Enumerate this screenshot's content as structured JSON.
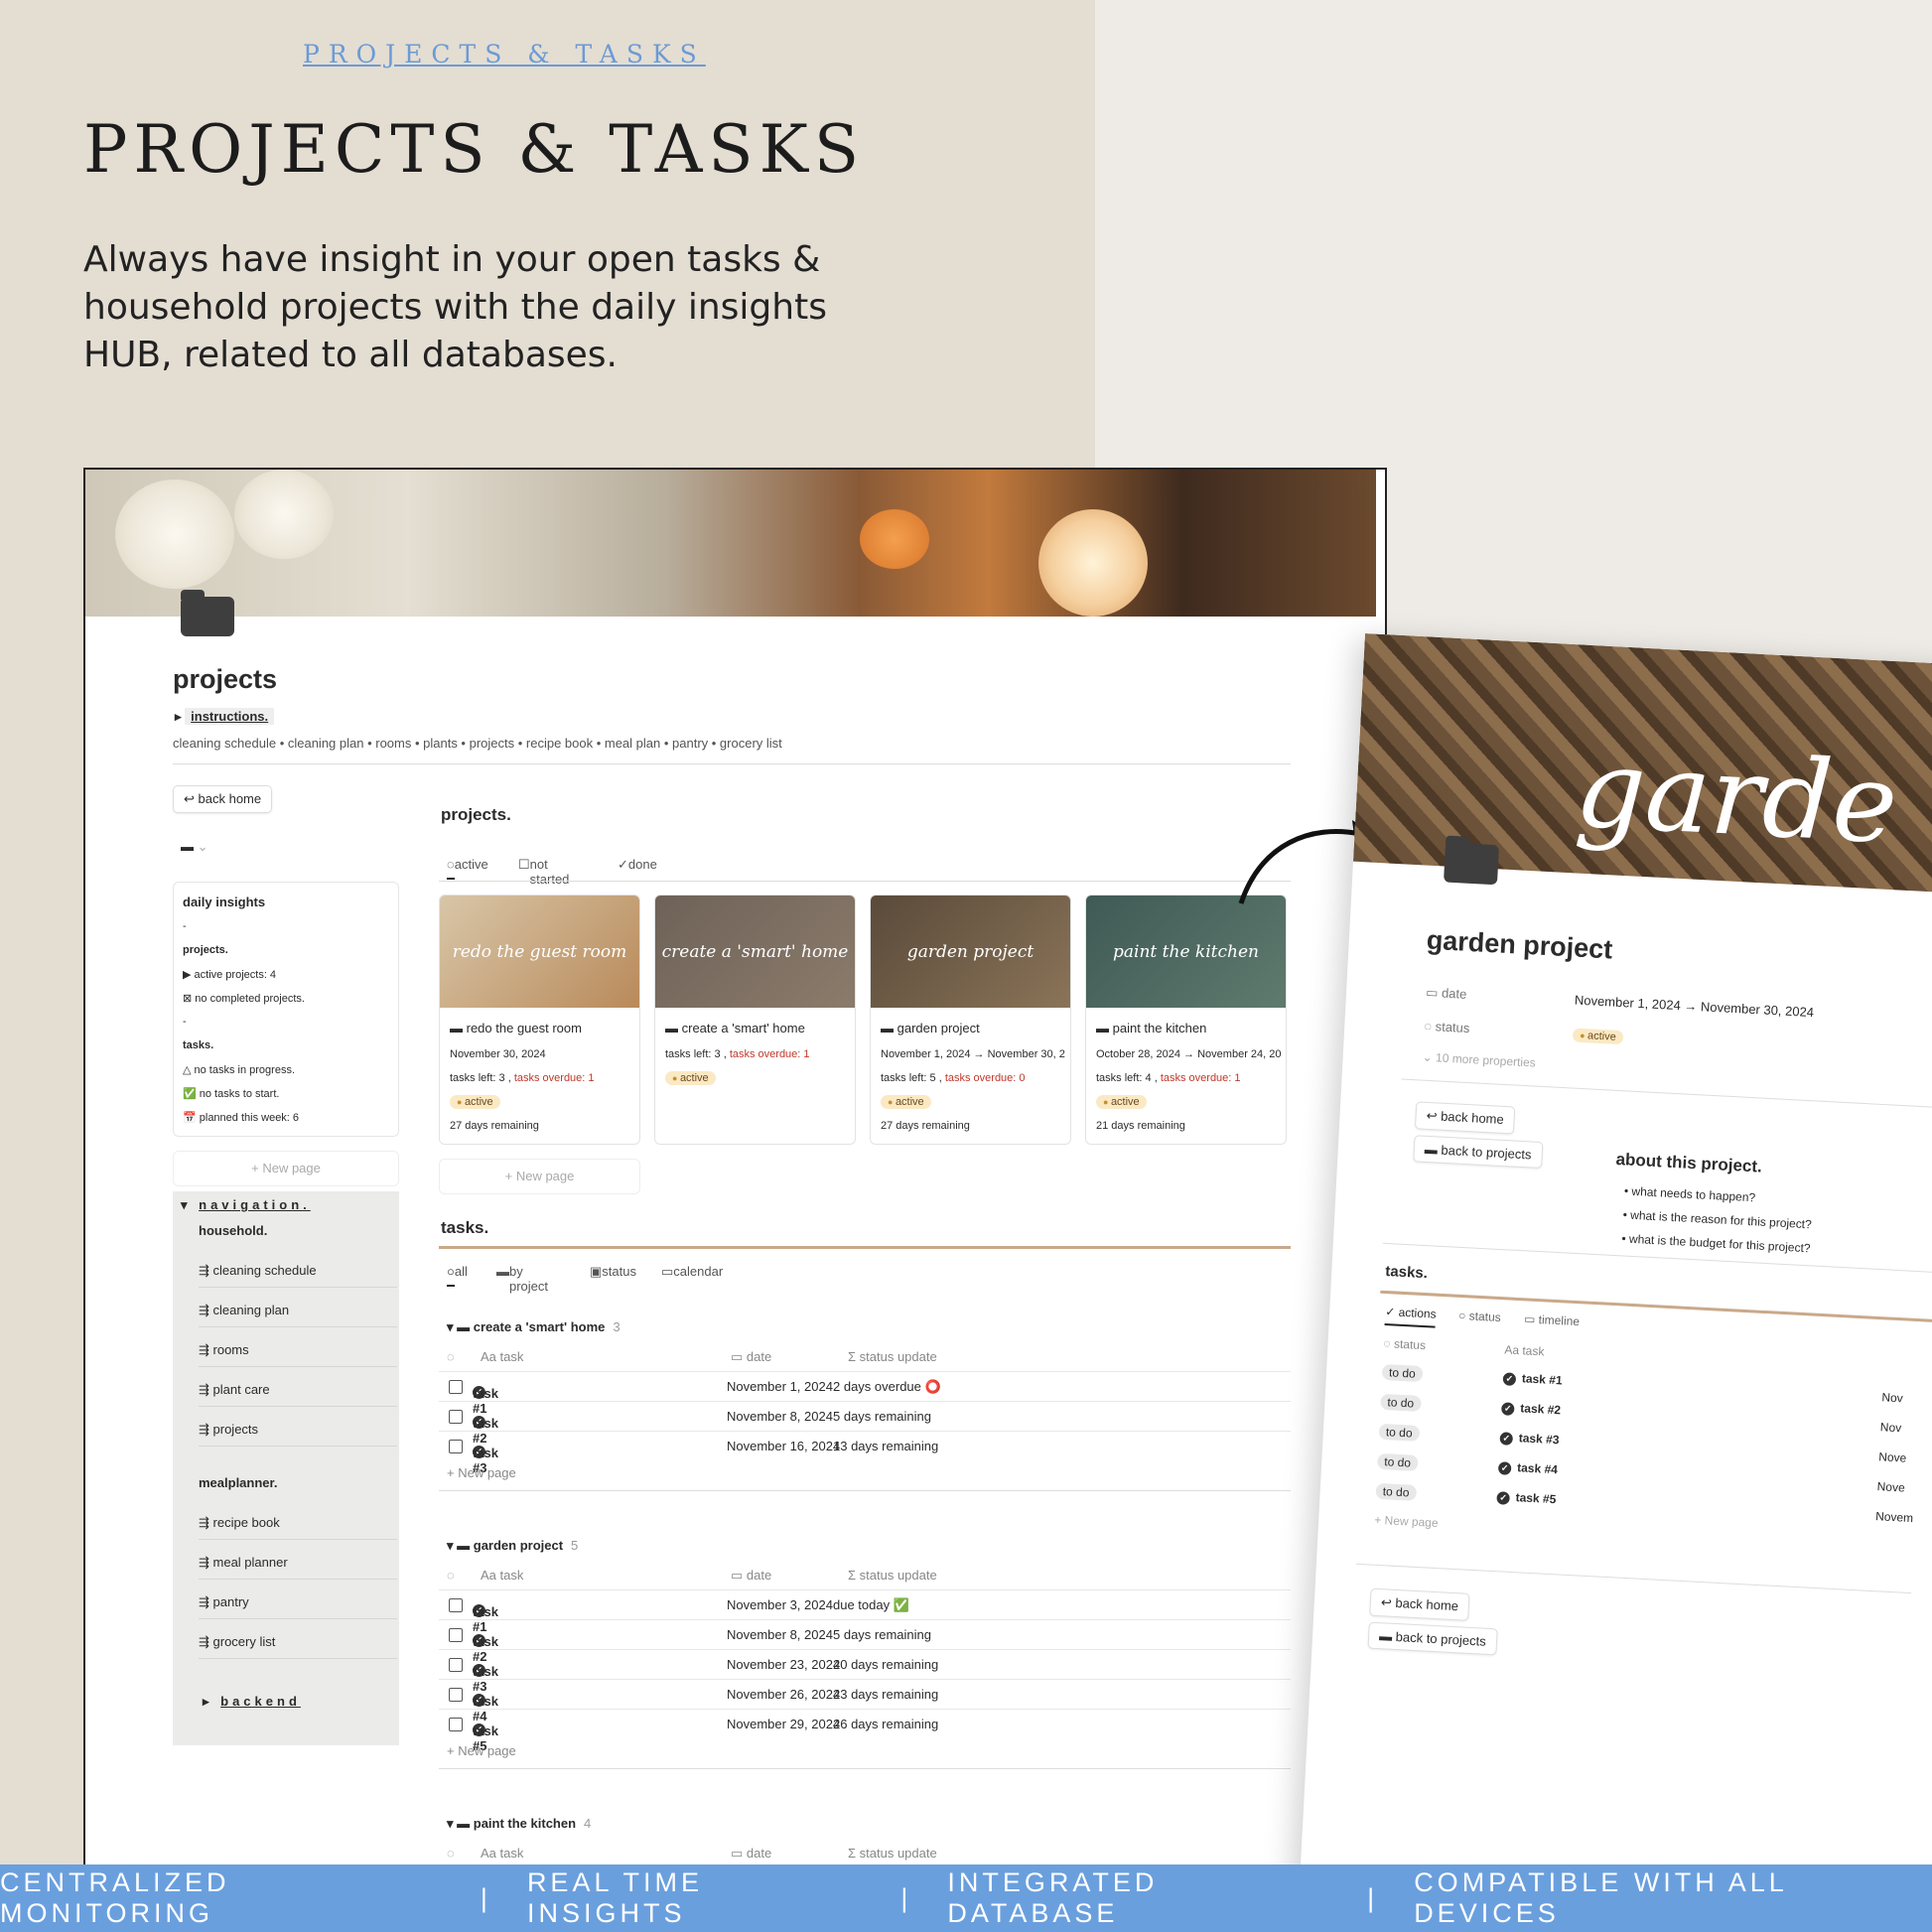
{
  "marketing": {
    "eyebrow": "PROJECTS & TASKS",
    "title": "PROJECTS & TASKS",
    "description": "Always have insight in your open tasks & household projects with the daily insights HUB, related to all databases."
  },
  "footer": {
    "items": [
      "CENTRALIZED MONITORING",
      "|",
      "REAL TIME INSIGHTS",
      "|",
      "INTEGRATED DATABASE",
      "|",
      "COMPATIBLE WITH ALL DEVICES"
    ]
  },
  "page": {
    "title": "projects",
    "instructions": "instructions.",
    "breadcrumbs": "cleaning schedule • cleaning plan • rooms • plants • projects • recipe book • meal plan • pantry • grocery list",
    "back_home": "back home"
  },
  "insights": {
    "title": "daily insights",
    "dash1": "-",
    "projects_label": "projects.",
    "active_projects": "▶ active projects: 4",
    "completed": "⊠ no completed projects.",
    "dash2": "-",
    "tasks_label": "tasks.",
    "in_progress": "△ no tasks in progress.",
    "to_start": "✅ no tasks to start.",
    "planned": "📅 planned this week: 6"
  },
  "new_page": "+ New page",
  "navigation": {
    "title": "navigation.",
    "household": "household.",
    "household_items": [
      "cleaning schedule",
      "cleaning plan",
      "rooms",
      "plant care",
      "projects"
    ],
    "mealplanner": "mealplanner.",
    "meal_items": [
      "recipe book",
      "meal planner",
      "pantry",
      "grocery list"
    ],
    "backend": "backend"
  },
  "projects_section": {
    "title": "projects.",
    "tabs": [
      "active",
      "not started",
      "done"
    ],
    "cards": [
      {
        "cover": "redo the guest room",
        "title": "redo the guest room",
        "line1": "November 30, 2024",
        "tasks": "tasks left: 3 ,",
        "overdue": "tasks overdue: 1",
        "status": "active",
        "remaining": "27 days remaining"
      },
      {
        "cover": "create a 'smart' home",
        "title": "create a 'smart' home",
        "line1": "",
        "tasks": "tasks left: 3 ,",
        "overdue": "tasks overdue: 1",
        "status": "active",
        "remaining": ""
      },
      {
        "cover": "garden project",
        "title": "garden project",
        "line1": "November 1, 2024 → November 30, 2",
        "tasks": "tasks left: 5 ,",
        "overdue": "tasks overdue: 0",
        "status": "active",
        "remaining": "27 days remaining"
      },
      {
        "cover": "paint the kitchen",
        "title": "paint the kitchen",
        "line1": "October 28, 2024 → November 24, 20",
        "tasks": "tasks left: 4 ,",
        "overdue": "tasks overdue: 1",
        "status": "active",
        "remaining": "21 days remaining"
      }
    ]
  },
  "tasks_section": {
    "title": "tasks.",
    "tabs": [
      "all",
      "by project",
      "status",
      "calendar"
    ],
    "col_task": "Aa task",
    "col_date": "date",
    "col_status": "Σ status update",
    "new_page": "+ New page",
    "groups": [
      {
        "name": "create a 'smart' home",
        "count": "3",
        "rows": [
          {
            "task": "task #1",
            "date": "November 1, 2024",
            "status": "2 days overdue ⭕"
          },
          {
            "task": "task #2",
            "date": "November 8, 2024",
            "status": "5 days remaining"
          },
          {
            "task": "task #3",
            "date": "November 16, 2024",
            "status": "13 days remaining"
          }
        ]
      },
      {
        "name": "garden project",
        "count": "5",
        "rows": [
          {
            "task": "task #1",
            "date": "November 3, 2024",
            "status": "due today ✅"
          },
          {
            "task": "task #2",
            "date": "November 8, 2024",
            "status": "5 days remaining"
          },
          {
            "task": "task #3",
            "date": "November 23, 2024",
            "status": "20 days remaining"
          },
          {
            "task": "task #4",
            "date": "November 26, 2024",
            "status": "23 days remaining"
          },
          {
            "task": "task #5",
            "date": "November 29, 2024",
            "status": "26 days remaining"
          }
        ]
      },
      {
        "name": "paint the kitchen",
        "count": "4",
        "rows": []
      }
    ]
  },
  "garden": {
    "cover_script": "garde",
    "title": "garden project",
    "date_label": "date",
    "date_value": "November 1, 2024 → November 30, 2024",
    "status_label": "status",
    "status_value": "active",
    "more": "10 more properties",
    "back_home": "back home",
    "back_projects": "back to projects",
    "about": "about this project.",
    "bullets": [
      "what needs to happen?",
      "what is the reason for this project?",
      "what is the budget for this project?"
    ],
    "tasks_title": "tasks.",
    "tabs": [
      "actions",
      "status",
      "timeline"
    ],
    "col_status": "status",
    "col_task": "Aa task",
    "todo": "to do",
    "tasks": [
      "task #1",
      "task #2",
      "task #3",
      "task #4",
      "task #5"
    ],
    "date_stubs": [
      "Nov",
      "Nov",
      "Nove",
      "Nove",
      "Novem"
    ],
    "new_page": "+ New page"
  },
  "colors": {
    "accent_blue": "#6a9fde",
    "active_pill": "#fbe9c4",
    "overdue_red": "#c0392b"
  }
}
